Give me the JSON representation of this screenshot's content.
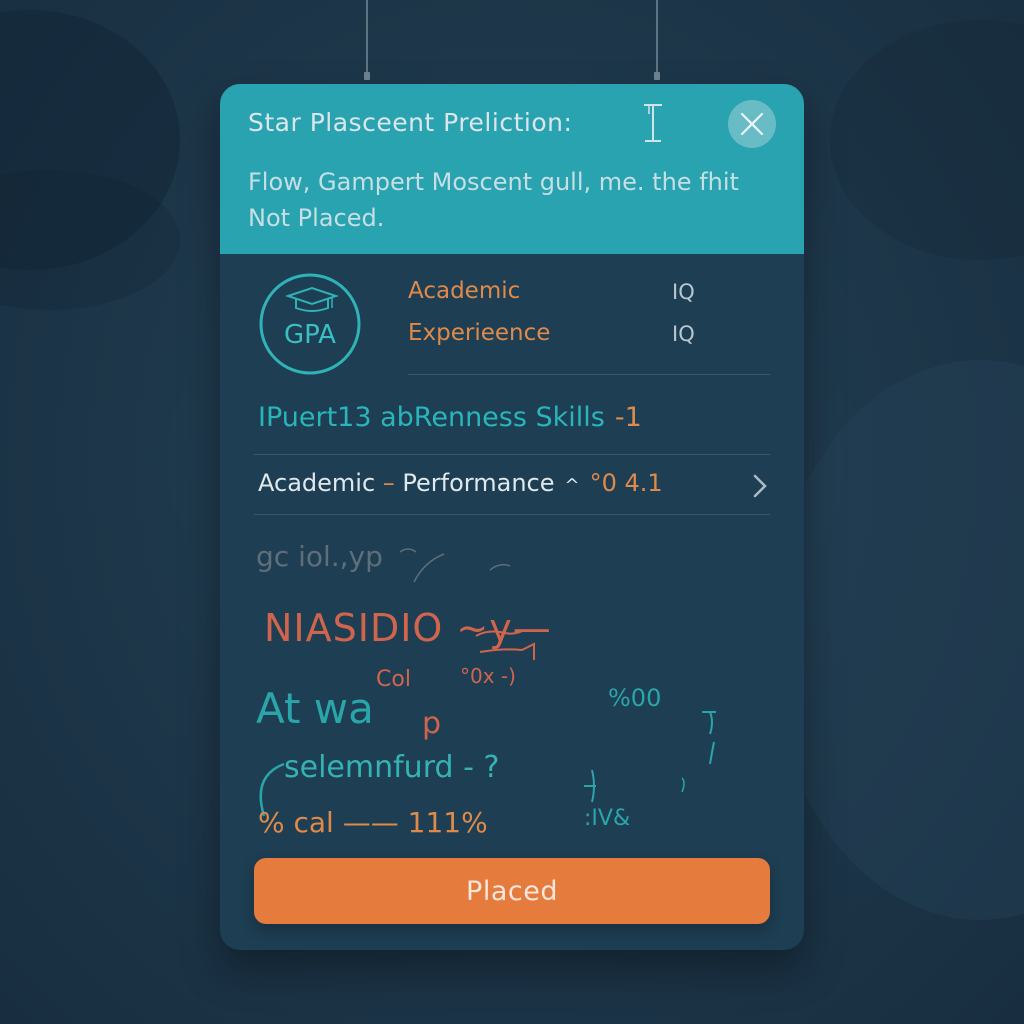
{
  "header": {
    "title": "Star Plasceent Preliction:",
    "message": "Flow, Gampert Moscent gull, me. the fhit Not Placed.",
    "close_icon": "close-icon",
    "accent_color": "#2aa3b0"
  },
  "badge": {
    "text": "GPA",
    "icon": "graduation-cap-icon"
  },
  "metrics": [
    {
      "label": "Academic",
      "value": "IQ"
    },
    {
      "label": "Experieence",
      "value": "IQ"
    }
  ],
  "skills": {
    "text": "IPuert13 abRenness Skills",
    "delta": "-1"
  },
  "performance": {
    "label_a": "Academic",
    "dash": "–",
    "label_b": "Performance",
    "caret": "^",
    "value": "°0 4.1",
    "chevron_icon": "chevron-right-icon"
  },
  "scribbles": {
    "line1": "gc iol.,yp",
    "line2": "NIASIDIO ~y—",
    "line3": "At wa",
    "line4": "selemnfurd - ?",
    "line5": "% cal —— 111%",
    "fragment_col": "Col",
    "fragment_ox": "°0x -)",
    "fragment_pct": "%00",
    "fragment_iv": ":IV&",
    "fragment_p": "p"
  },
  "action": {
    "label": "Placed",
    "color": "#e57b3c"
  }
}
